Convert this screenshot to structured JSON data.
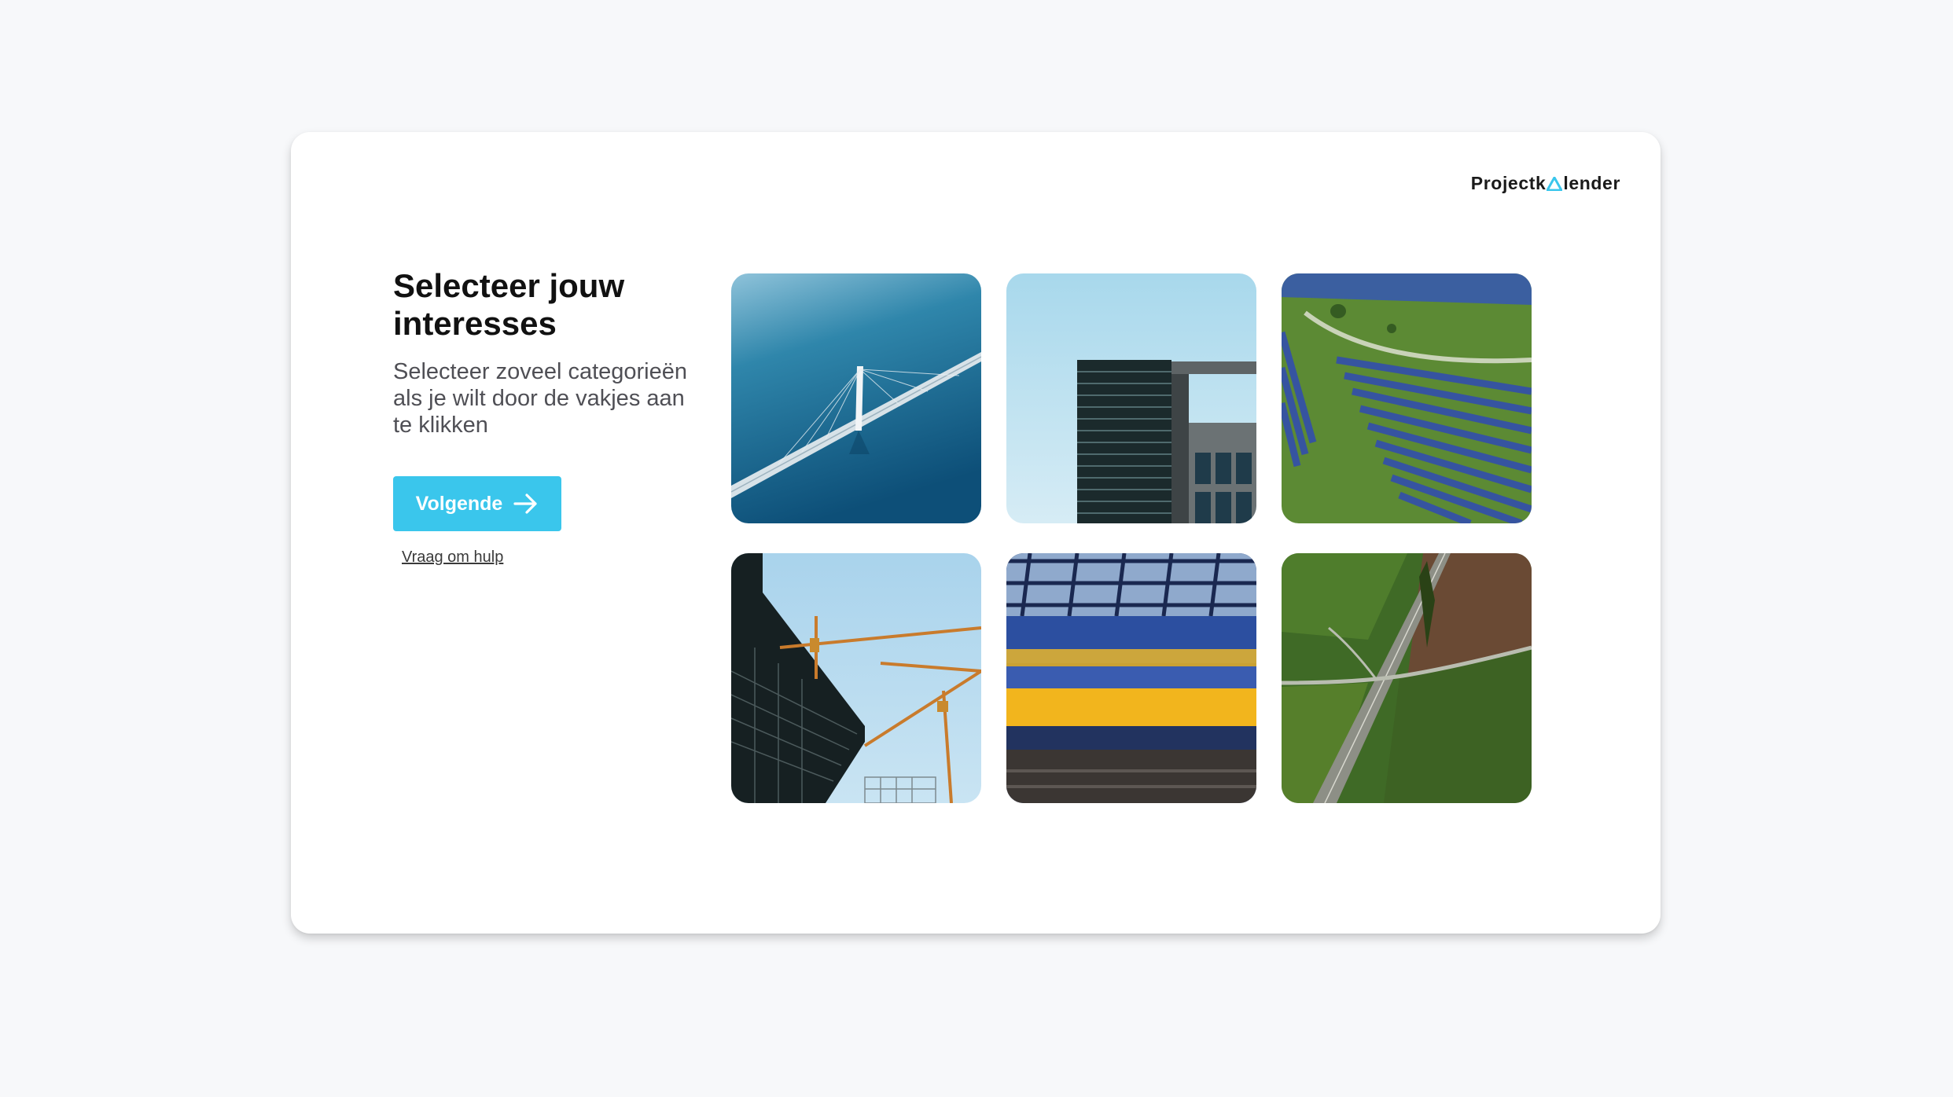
{
  "brand": {
    "logo_prefix": "Projectk",
    "logo_suffix": "lender",
    "accent_color": "#3ac6ec"
  },
  "intro": {
    "title": "Selecteer jouw interesses",
    "subtitle": "Selecteer zoveel categorieën als je wilt door de vakjes aan te klikken"
  },
  "actions": {
    "next_label": "Volgende",
    "next_icon": "arrow-right-icon",
    "help_link": "Vraag om hulp"
  },
  "categories": [
    {
      "id": "bridge",
      "image": "suspension bridge over water"
    },
    {
      "id": "building",
      "image": "modern office building facade"
    },
    {
      "id": "solar",
      "image": "solar panel field"
    },
    {
      "id": "construction",
      "image": "construction cranes"
    },
    {
      "id": "train",
      "image": "moving yellow-blue train"
    },
    {
      "id": "road",
      "image": "highway through fields"
    }
  ]
}
